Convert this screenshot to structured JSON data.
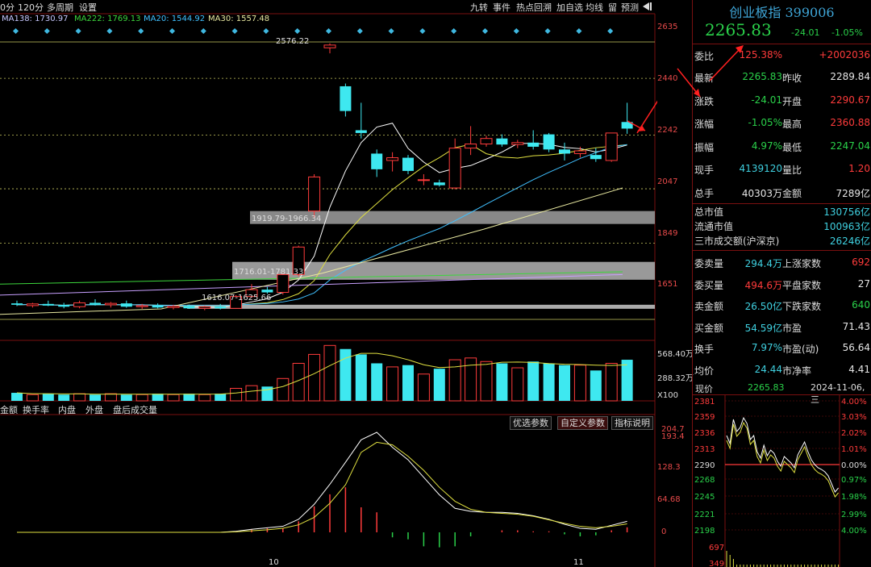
{
  "toolbar": {
    "left_items": [
      "0分",
      "120分",
      "多周期",
      "设置"
    ],
    "right_items": [
      "九转",
      "事件",
      "热点回溯",
      "加自选",
      "均线",
      "留",
      "预测"
    ]
  },
  "ma_legend": [
    {
      "label": "MA138: 1730.97",
      "color": "#c8c8ff"
    },
    {
      "label": "MA222: 1769.13",
      "color": "#3cd63c"
    },
    {
      "label": "MA20: 1544.92",
      "color": "#40c0ff"
    },
    {
      "label": "MA30: 1557.48",
      "color": "#e8e8a0"
    }
  ],
  "price_axis_ticks": [
    "2635",
    "2440",
    "2242",
    "2047",
    "1849",
    "1651"
  ],
  "volume_axis_ticks": [
    "568.40万",
    "288.32万",
    "X100"
  ],
  "macd_axis_ticks": [
    "204.7",
    "193.4",
    "128.3",
    "64.68",
    "0"
  ],
  "date_labels": [
    "10",
    "11"
  ],
  "annotations": {
    "high": "2576.22",
    "gap1": "1919.79-1966.34",
    "gap2": "1716.01-1781.33",
    "gap3": "1616.07-1625.66"
  },
  "indicator_tabs": [
    "金额",
    "换手率",
    "内盘",
    "外盘",
    "盘后成交量"
  ],
  "indicator_buttons": {
    "optional": "优选参数",
    "custom": "自定义参数",
    "explain": "指标说明"
  },
  "quote": {
    "title": "创业板指 399006",
    "price": "2265.83",
    "change": "-24.01",
    "change_pct": "-1.05%",
    "rows": [
      {
        "l1": "委比",
        "v1": "125.38%",
        "c1": "red",
        "l2": "",
        "v2": "+2002036",
        "c2": "red"
      },
      {
        "l1": "最新",
        "v1": "2265.83",
        "c1": "grn",
        "l2": "昨收",
        "v2": "2289.84",
        "c2": "wht"
      },
      {
        "l1": "涨跌",
        "v1": "-24.01",
        "c1": "grn",
        "l2": "开盘",
        "v2": "2290.67",
        "c2": "red"
      },
      {
        "l1": "涨幅",
        "v1": "-1.05%",
        "c1": "grn",
        "l2": "最高",
        "v2": "2360.88",
        "c2": "red"
      },
      {
        "l1": "振幅",
        "v1": "4.97%",
        "c1": "grn",
        "l2": "最低",
        "v2": "2247.04",
        "c2": "grn"
      },
      {
        "l1": "现手",
        "v1": "4139120",
        "c1": "cy",
        "l2": "量比",
        "v2": "1.20",
        "c2": "red"
      },
      {
        "l1": "总手",
        "v1": "40303万",
        "c1": "wht",
        "l2": "金额",
        "v2": "7289亿",
        "c2": "wht"
      }
    ],
    "market": [
      {
        "l": "总市值",
        "v": "130756亿"
      },
      {
        "l": "流通市值",
        "v": "100963亿"
      },
      {
        "l": "三市成交额(沪深京)",
        "v": "26246亿"
      }
    ],
    "rows2": [
      {
        "l1": "委卖量",
        "v1": "294.4万",
        "c1": "cy",
        "l2": "上涨家数",
        "v2": "692",
        "c2": "red"
      },
      {
        "l1": "委买量",
        "v1": "494.6万",
        "c1": "red",
        "l2": "平盘家数",
        "v2": "27",
        "c2": "wht"
      },
      {
        "l1": "卖金额",
        "v1": "26.50亿",
        "c1": "cy",
        "l2": "下跌家数",
        "v2": "640",
        "c2": "grn"
      },
      {
        "l1": "买金额",
        "v1": "54.59亿",
        "c1": "cy",
        "l2": "市盈",
        "v2": "71.43",
        "c2": "wht"
      },
      {
        "l1": "换手",
        "v1": "7.97%",
        "c1": "cy",
        "l2": "市盈(动)",
        "v2": "56.64",
        "c2": "wht"
      },
      {
        "l1": "均价",
        "v1": "24.44",
        "c1": "cy",
        "l2": "市净率",
        "v2": "4.41",
        "c2": "wht"
      }
    ]
  },
  "intraday": {
    "label": "现价",
    "price": "2265.83",
    "date": "2024-11-06,三",
    "left_ticks": [
      "2381",
      "2359",
      "2336",
      "2313",
      "2290",
      "2268",
      "2245",
      "2221",
      "2198",
      "697",
      "349"
    ],
    "right_ticks": [
      "4.00%",
      "3.03%",
      "2.02%",
      "1.01%",
      "0.00%",
      "0.97%",
      "1.98%",
      "2.99%",
      "4.00%"
    ]
  },
  "colors": {
    "up": "#ff3b3b",
    "down": "#3ee8f0",
    "bg": "#000000",
    "grid": "#7a1010"
  },
  "chart_data": {
    "type": "candlestick",
    "ylim": [
      1560,
      2640
    ],
    "candles": [
      {
        "o": 1630,
        "h": 1640,
        "l": 1620,
        "c": 1625
      },
      {
        "o": 1622,
        "h": 1632,
        "l": 1615,
        "c": 1628
      },
      {
        "o": 1628,
        "h": 1640,
        "l": 1620,
        "c": 1622
      },
      {
        "o": 1624,
        "h": 1632,
        "l": 1612,
        "c": 1618
      },
      {
        "o": 1618,
        "h": 1640,
        "l": 1612,
        "c": 1632
      },
      {
        "o": 1632,
        "h": 1645,
        "l": 1622,
        "c": 1625
      },
      {
        "o": 1625,
        "h": 1635,
        "l": 1615,
        "c": 1630
      },
      {
        "o": 1630,
        "h": 1640,
        "l": 1614,
        "c": 1618
      },
      {
        "o": 1618,
        "h": 1628,
        "l": 1610,
        "c": 1622
      },
      {
        "o": 1622,
        "h": 1630,
        "l": 1612,
        "c": 1615
      },
      {
        "o": 1615,
        "h": 1625,
        "l": 1608,
        "c": 1620
      },
      {
        "o": 1620,
        "h": 1626,
        "l": 1610,
        "c": 1612
      },
      {
        "o": 1612,
        "h": 1622,
        "l": 1605,
        "c": 1618
      },
      {
        "o": 1618,
        "h": 1628,
        "l": 1608,
        "c": 1612
      },
      {
        "o": 1612,
        "h": 1660,
        "l": 1610,
        "c": 1655
      },
      {
        "o": 1655,
        "h": 1700,
        "l": 1650,
        "c": 1680
      },
      {
        "o": 1680,
        "h": 1690,
        "l": 1665,
        "c": 1670
      },
      {
        "o": 1670,
        "h": 1740,
        "l": 1662,
        "c": 1735
      },
      {
        "o": 1735,
        "h": 1840,
        "l": 1728,
        "c": 1835
      },
      {
        "o": 1966,
        "h": 2100,
        "l": 1940,
        "c": 2090
      },
      {
        "o": 2560,
        "h": 2576,
        "l": 2540,
        "c": 2570
      },
      {
        "o": 2420,
        "h": 2430,
        "l": 2310,
        "c": 2330
      },
      {
        "o": 2260,
        "h": 2360,
        "l": 2230,
        "c": 2250
      },
      {
        "o": 2175,
        "h": 2190,
        "l": 2090,
        "c": 2118
      },
      {
        "o": 2150,
        "h": 2180,
        "l": 2110,
        "c": 2160
      },
      {
        "o": 2160,
        "h": 2170,
        "l": 2100,
        "c": 2112
      },
      {
        "o": 2080,
        "h": 2100,
        "l": 2060,
        "c": 2080
      },
      {
        "o": 2070,
        "h": 2080,
        "l": 2055,
        "c": 2060
      },
      {
        "o": 2050,
        "h": 2230,
        "l": 2045,
        "c": 2195
      },
      {
        "o": 2195,
        "h": 2275,
        "l": 2170,
        "c": 2210
      },
      {
        "o": 2210,
        "h": 2240,
        "l": 2200,
        "c": 2230
      },
      {
        "o": 2230,
        "h": 2245,
        "l": 2200,
        "c": 2208
      },
      {
        "o": 2208,
        "h": 2225,
        "l": 2195,
        "c": 2215
      },
      {
        "o": 2215,
        "h": 2260,
        "l": 2190,
        "c": 2200
      },
      {
        "o": 2245,
        "h": 2250,
        "l": 2180,
        "c": 2190
      },
      {
        "o": 2190,
        "h": 2215,
        "l": 2150,
        "c": 2175
      },
      {
        "o": 2175,
        "h": 2200,
        "l": 2160,
        "c": 2185
      },
      {
        "o": 2170,
        "h": 2195,
        "l": 2145,
        "c": 2155
      },
      {
        "o": 2150,
        "h": 2220,
        "l": 2145,
        "c": 2250
      },
      {
        "o": 2290,
        "h": 2360,
        "l": 2247,
        "c": 2266
      }
    ],
    "volumes": [
      0.09,
      0.07,
      0.08,
      0.07,
      0.08,
      0.07,
      0.08,
      0.07,
      0.07,
      0.08,
      0.07,
      0.08,
      0.07,
      0.08,
      0.14,
      0.17,
      0.16,
      0.25,
      0.42,
      0.52,
      0.62,
      0.58,
      0.52,
      0.42,
      0.38,
      0.4,
      0.3,
      0.36,
      0.46,
      0.48,
      0.44,
      0.42,
      0.37,
      0.44,
      0.42,
      0.4,
      0.4,
      0.34,
      0.42,
      0.46
    ],
    "macd_dif": [
      0,
      0,
      0,
      0,
      0,
      0,
      0,
      0,
      0,
      0,
      0,
      0,
      0,
      0,
      2,
      6,
      9,
      12,
      26,
      56,
      96,
      140,
      185,
      200,
      170,
      145,
      110,
      75,
      48,
      42,
      40,
      40,
      38,
      33,
      26,
      16,
      8,
      6,
      14,
      22
    ],
    "macd_dea": [
      0,
      0,
      0,
      0,
      0,
      0,
      0,
      0,
      0,
      0,
      0,
      0,
      0,
      0,
      1,
      3,
      5,
      8,
      15,
      30,
      58,
      95,
      160,
      180,
      175,
      152,
      124,
      90,
      62,
      46,
      40,
      38,
      36,
      32,
      25,
      18,
      12,
      9,
      12,
      17
    ]
  }
}
